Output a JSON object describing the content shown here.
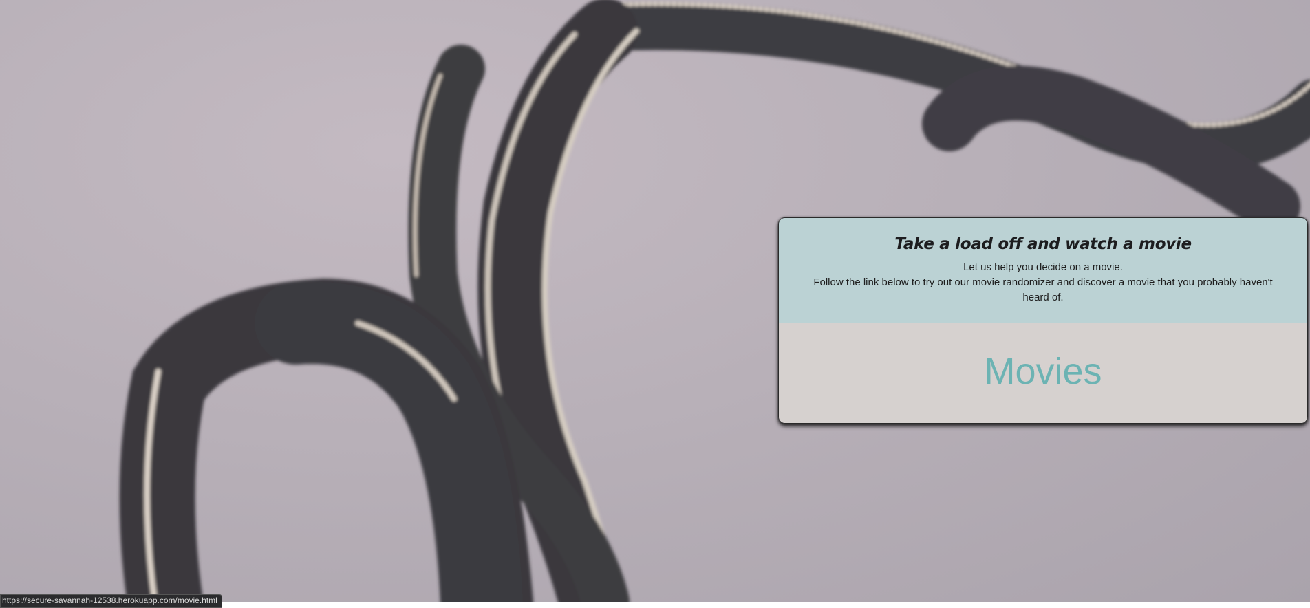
{
  "card": {
    "title": "Take a load off and watch a movie",
    "intro_line": "Let us help you decide on a movie.",
    "instruction_line": "Follow the link below to try out our movie randomizer and discover a movie that you probably haven't heard of.",
    "link_label": "Movies"
  },
  "status_bar": {
    "url": "https://secure-savannah-12538.herokuapp.com/movie.html"
  },
  "colors": {
    "header_bg": "#bbd2d4",
    "body_bg": "#d6d1cf",
    "link": "#6cb3b3",
    "page_bg": "#b8b0b8"
  },
  "icons": {
    "background": "film-strip-background-image"
  }
}
